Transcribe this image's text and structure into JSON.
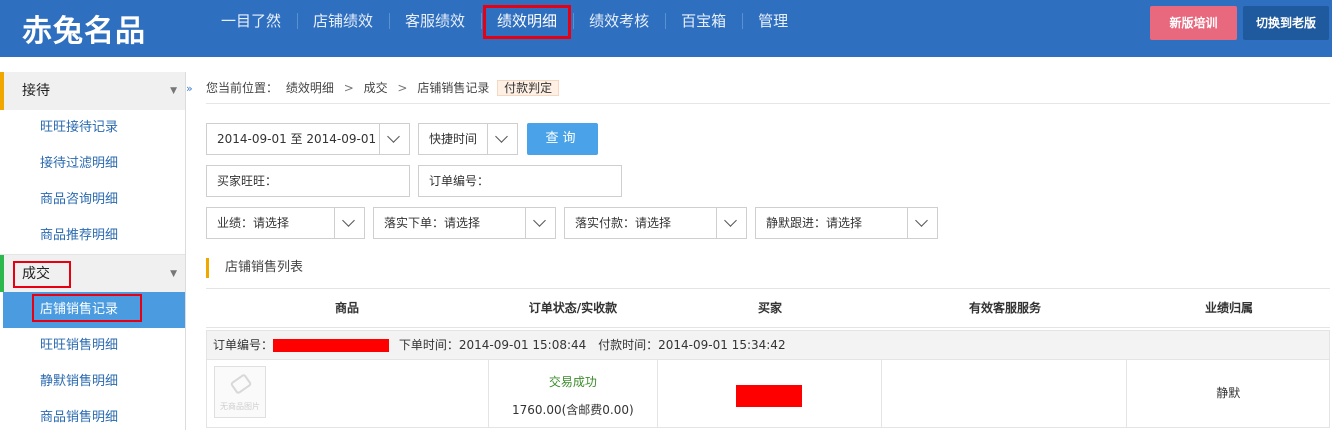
{
  "header": {
    "logo": "赤兔名品",
    "nav": [
      "一目了然",
      "店铺绩效",
      "客服绩效",
      "绩效明细",
      "绩效考核",
      "百宝箱",
      "管理"
    ],
    "active_nav": "绩效明细",
    "btn_new": "新版培训",
    "btn_old": "切换到老版"
  },
  "sidebar": {
    "group1": {
      "label": "接待",
      "items": [
        "旺旺接待记录",
        "接待过滤明细",
        "商品咨询明细",
        "商品推荐明细"
      ]
    },
    "group2": {
      "label": "成交",
      "items": [
        "店铺销售记录",
        "旺旺销售明细",
        "静默销售明细",
        "商品销售明细"
      ]
    },
    "collapse_glyph": "»",
    "caret_glyph": "▼"
  },
  "breadcrumb": {
    "prefix": "您当前位置：",
    "items": [
      "绩效明细",
      "成交",
      "店铺销售记录"
    ],
    "sep": ">",
    "tag": "付款判定"
  },
  "filters": {
    "date_range": "2014-09-01 至 2014-09-01",
    "quick_time": "快捷时间",
    "query_btn": "查询",
    "buyer_label": "买家旺旺：",
    "order_label": "订单编号：",
    "perf": "业绩：请选择",
    "order_placed": "落实下单：请选择",
    "payment": "落实付款：请选择",
    "silent_follow": "静默跟进：请选择"
  },
  "list": {
    "title": "店铺销售列表",
    "columns": [
      "商品",
      "订单状态/实收款",
      "买家",
      "有效客服服务",
      "业绩归属"
    ],
    "order": {
      "label": "订单编号：",
      "order_time": "下单时间：2014-09-01 15:08:44",
      "pay_time": "付款时间：2014-09-01 15:34:42",
      "status": "交易成功",
      "amount": "1760.00(含邮费0.00)",
      "no_image": "无商品图片",
      "attribution": "静默"
    }
  },
  "colors": {
    "topbar": "#2f6fbf",
    "accent_blue": "#4aa3e8",
    "highlight_red": "#e60012",
    "status_green": "#3a8c2a"
  }
}
